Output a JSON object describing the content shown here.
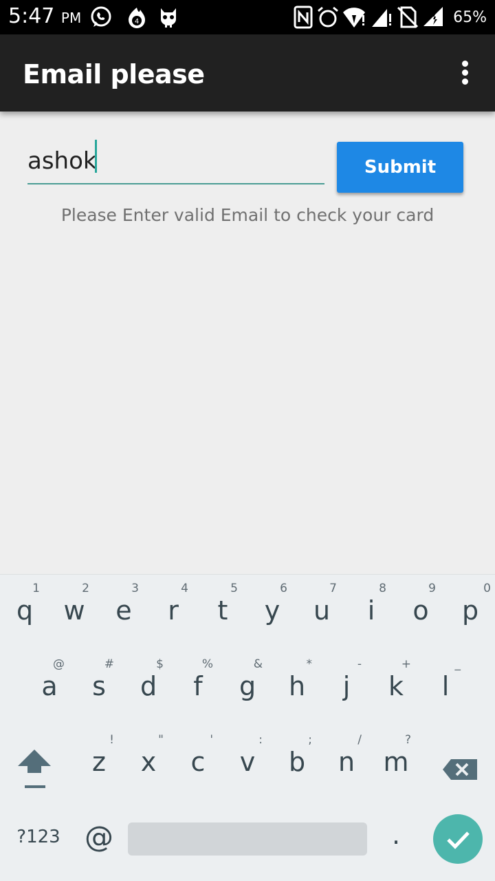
{
  "status_bar": {
    "time": "5:47",
    "ampm": "PM",
    "battery": "65%"
  },
  "app_bar": {
    "title": "Email please"
  },
  "form": {
    "email_value": "ashok",
    "submit_label": "Submit",
    "hint": "Please Enter valid Email to check your card"
  },
  "keyboard": {
    "row1": [
      {
        "key": "q",
        "hint": "1"
      },
      {
        "key": "w",
        "hint": "2"
      },
      {
        "key": "e",
        "hint": "3"
      },
      {
        "key": "r",
        "hint": "4"
      },
      {
        "key": "t",
        "hint": "5"
      },
      {
        "key": "y",
        "hint": "6"
      },
      {
        "key": "u",
        "hint": "7"
      },
      {
        "key": "i",
        "hint": "8"
      },
      {
        "key": "o",
        "hint": "9"
      },
      {
        "key": "p",
        "hint": "0"
      }
    ],
    "row2": [
      {
        "key": "a",
        "hint": "@"
      },
      {
        "key": "s",
        "hint": "#"
      },
      {
        "key": "d",
        "hint": "$"
      },
      {
        "key": "f",
        "hint": "%"
      },
      {
        "key": "g",
        "hint": "&"
      },
      {
        "key": "h",
        "hint": "*"
      },
      {
        "key": "j",
        "hint": "-"
      },
      {
        "key": "k",
        "hint": "+"
      },
      {
        "key": "l",
        "hint": "_"
      }
    ],
    "row3": [
      {
        "key": "z",
        "hint": "!"
      },
      {
        "key": "x",
        "hint": "\""
      },
      {
        "key": "c",
        "hint": "'"
      },
      {
        "key": "v",
        "hint": ":"
      },
      {
        "key": "b",
        "hint": ";"
      },
      {
        "key": "n",
        "hint": "/"
      },
      {
        "key": "m",
        "hint": "?"
      }
    ],
    "symbols_label": "?123",
    "at_label": "@",
    "dot_label": "."
  },
  "icons": {
    "status": [
      "whatsapp-icon",
      "notification-badge-icon",
      "cyanogen-mascot-icon",
      "nfc-icon",
      "alarm-icon",
      "wifi-icon",
      "signal-icon",
      "no-sim-icon",
      "data-icon"
    ],
    "keyboard": [
      "shift-icon",
      "backspace-icon",
      "checkmark-icon"
    ]
  },
  "colors": {
    "appbar": "#212121",
    "accent": "#26a69a",
    "submit": "#1e88e5",
    "enter": "#4db6ac"
  }
}
